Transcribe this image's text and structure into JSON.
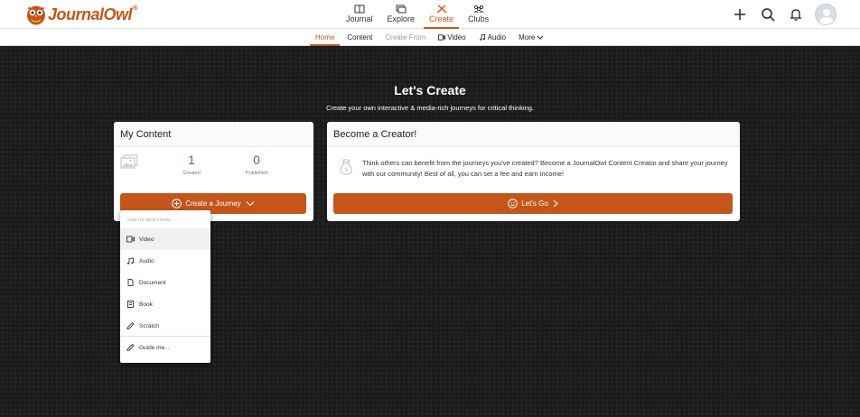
{
  "brand": {
    "name_part1": "Journal",
    "name_part2": "Owl",
    "reg": "®",
    "color": "#c4561b"
  },
  "main_nav": [
    {
      "label": "Journal",
      "icon": "journal-icon",
      "active": false
    },
    {
      "label": "Explore",
      "icon": "explore-icon",
      "active": false
    },
    {
      "label": "Create",
      "icon": "create-icon",
      "active": true
    },
    {
      "label": "Clubs",
      "icon": "clubs-icon",
      "active": false
    }
  ],
  "header_icons": [
    "plus-icon",
    "search-icon",
    "bell-icon",
    "avatar"
  ],
  "sub_nav": {
    "home": "Home",
    "content": "Content",
    "create_from": "Create From",
    "video": "Video",
    "audio": "Audio",
    "more": "More"
  },
  "hero": {
    "title": "Let's Create",
    "subtitle": "Create your own interactive & media-rich journeys for critical thinking."
  },
  "my_content": {
    "title": "My Content",
    "created_count": "1",
    "created_label": "Created",
    "published_count": "0",
    "published_label": "Published",
    "button_label": "Create a Journey"
  },
  "creator": {
    "title": "Become a Creator!",
    "text": "Think others can benefit from the journeys you've created? Become a JournalOwl Content Creator and share your journey with our community! Best of all, you can set a fee and earn income!",
    "button_label": "Let's Go"
  },
  "dropdown": {
    "heading": "CREATE NEW FROM",
    "items": [
      {
        "label": "Video",
        "icon": "video-icon"
      },
      {
        "label": "Audio",
        "icon": "music-note-icon"
      },
      {
        "label": "Document",
        "icon": "document-icon"
      },
      {
        "label": "Book",
        "icon": "book-icon"
      },
      {
        "label": "Scratch",
        "icon": "pencil-icon"
      },
      {
        "label": "Guide me...",
        "icon": "pencil-icon"
      }
    ]
  },
  "colors": {
    "accent": "#c4561b",
    "stat_blue": "#2e74b5",
    "background": "#1b1b1b"
  }
}
